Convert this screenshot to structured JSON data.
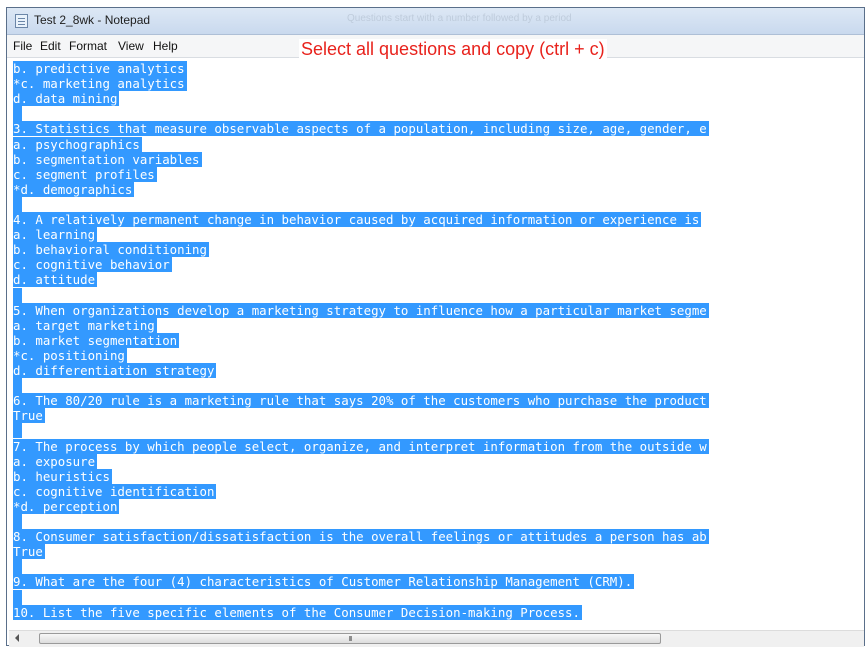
{
  "window": {
    "title": "Test 2_8wk - Notepad",
    "ghost_title": "Questions start with a number followed by a period"
  },
  "menu": [
    "File",
    "Edit",
    "Format",
    "View",
    "Help"
  ],
  "annotation": "Select all questions and copy (ctrl + c)",
  "lines": [
    "b. predictive analytics",
    "*c. marketing analytics",
    "d. data mining",
    "",
    "3. Statistics that measure observable aspects of a population, including size, age, gender, e",
    "a. psychographics",
    "b. segmentation variables",
    "c. segment profiles",
    "*d. demographics",
    "",
    "4. A relatively permanent change in behavior caused by acquired information or experience is",
    "a. learning",
    "b. behavioral conditioning",
    "c. cognitive behavior",
    "d. attitude",
    "",
    "5. When organizations develop a marketing strategy to influence how a particular market segme",
    "a. target marketing",
    "b. market segmentation",
    "*c. positioning",
    "d. differentiation strategy",
    "",
    "6. The 80/20 rule is a marketing rule that says 20% of the customers who purchase the product",
    "True",
    "",
    "7. The process by which people select, organize, and interpret information from the outside w",
    "a. exposure",
    "b. heuristics",
    "c. cognitive identification",
    "*d. perception",
    "",
    "8. Consumer satisfaction/dissatisfaction is the overall feelings or attitudes a person has ab",
    "True",
    "",
    "9. What are the four (4) characteristics of Customer Relationship Management (CRM).",
    "",
    "10. List the five specific elements of the Consumer Decision-making Process."
  ],
  "scrollbar": {
    "grip": "III"
  }
}
